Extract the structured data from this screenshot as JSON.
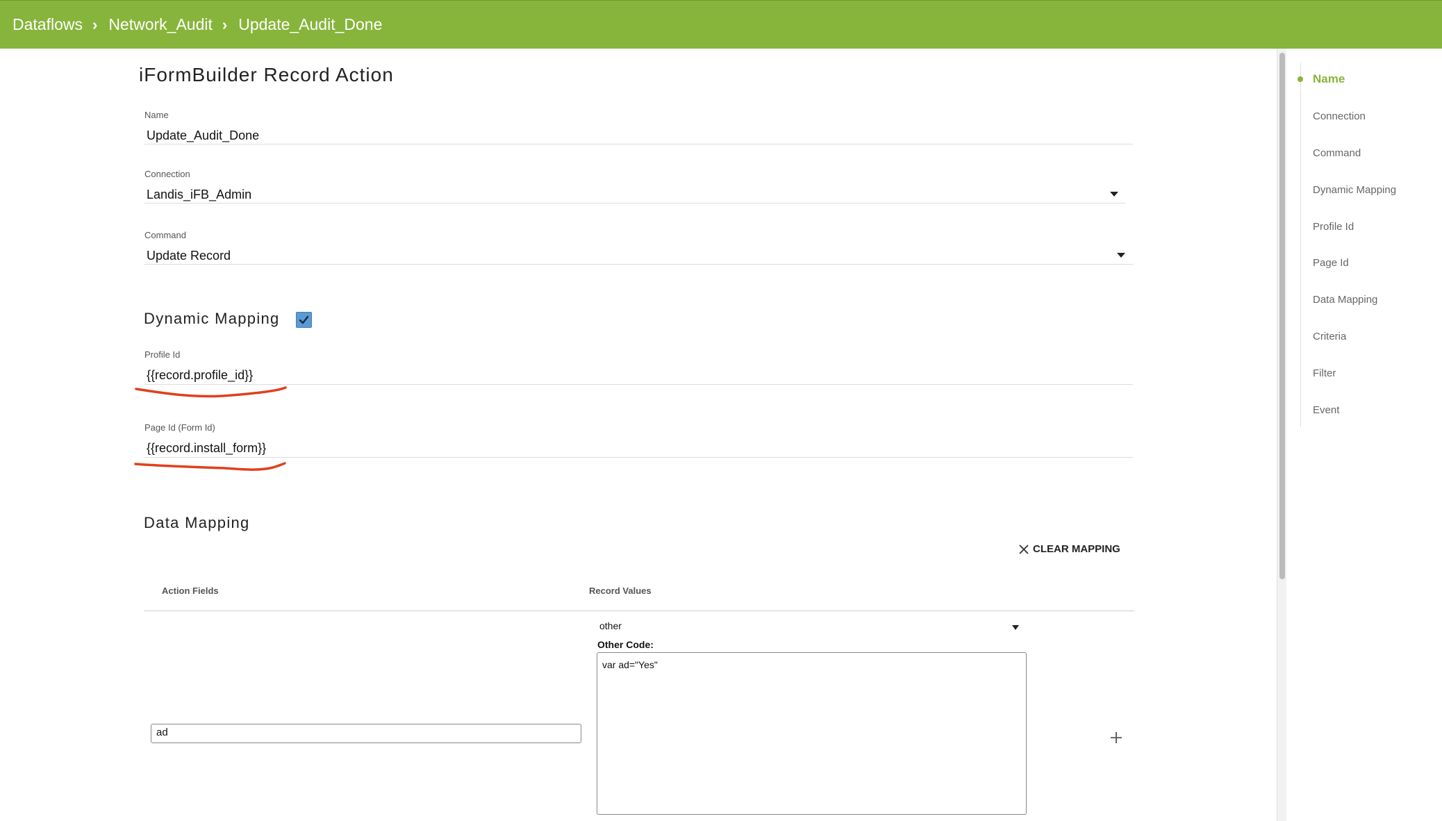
{
  "breadcrumb": {
    "items": [
      "Dataflows",
      "Network_Audit",
      "Update_Audit_Done"
    ],
    "separator": "›"
  },
  "page": {
    "title": "iFormBuilder Record Action"
  },
  "form": {
    "name": {
      "label": "Name",
      "value": "Update_Audit_Done"
    },
    "connection": {
      "label": "Connection",
      "value": "Landis_iFB_Admin"
    },
    "command": {
      "label": "Command",
      "value": "Update Record"
    },
    "dynamic_mapping": {
      "title": "Dynamic Mapping",
      "checked": true
    },
    "profile_id": {
      "label": "Profile Id",
      "value": "{{record.profile_id}}"
    },
    "page_id": {
      "label": "Page Id (Form Id)",
      "value": "{{record.install_form}}"
    }
  },
  "data_mapping": {
    "title": "Data Mapping",
    "clear_label": "CLEAR MAPPING",
    "columns": [
      "Action Fields",
      "Record Values"
    ],
    "rows": [
      {
        "action_field": "ad",
        "record_value_type": "other",
        "other_code_label": "Other Code:",
        "other_code": "var ad=\"Yes\""
      }
    ]
  },
  "sidenav": {
    "items": [
      "Name",
      "Connection",
      "Command",
      "Dynamic Mapping",
      "Profile Id",
      "Page Id",
      "Data Mapping",
      "Criteria",
      "Filter",
      "Event"
    ],
    "active": "Name"
  },
  "colors": {
    "brand_green": "#87b53b",
    "checkbox_blue": "#5b9bd5",
    "annotation_red": "#e0401c"
  },
  "icons": {
    "breadcrumb_separator": "chevron-right-icon",
    "dropdown": "caret-down-icon",
    "clear": "close-icon",
    "add": "plus-icon",
    "checkbox": "check-icon"
  }
}
